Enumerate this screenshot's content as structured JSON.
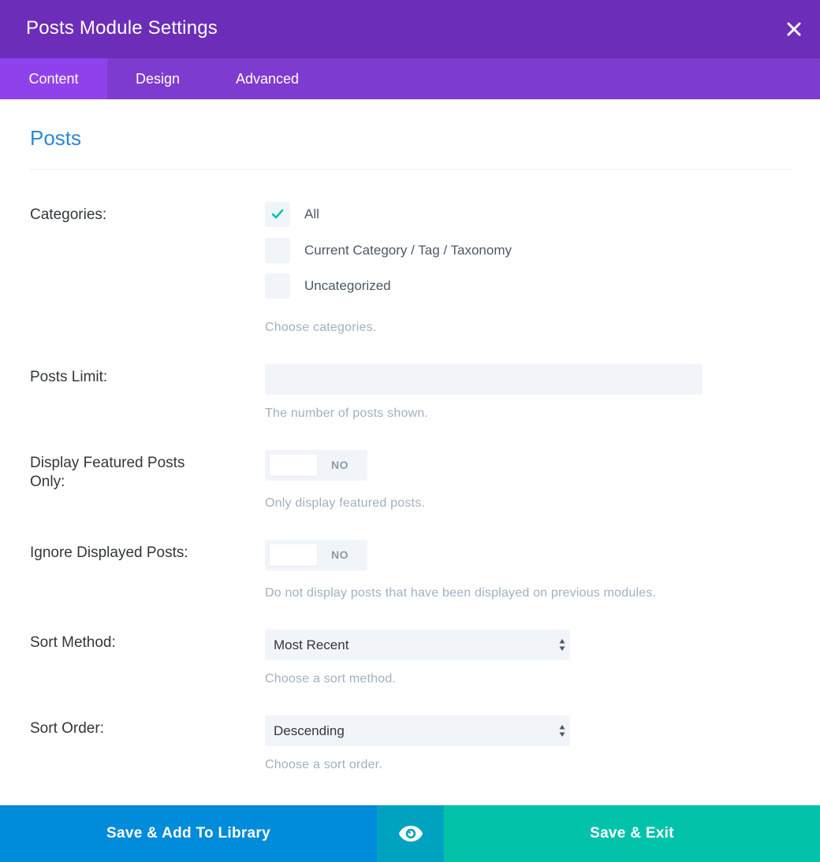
{
  "header": {
    "title": "Posts Module Settings",
    "close_icon": "close-icon"
  },
  "tabs": [
    {
      "label": "Content",
      "active": true
    },
    {
      "label": "Design",
      "active": false
    },
    {
      "label": "Advanced",
      "active": false
    }
  ],
  "section": {
    "title": "Posts"
  },
  "categories": {
    "label": "Categories:",
    "options": [
      {
        "label": "All",
        "checked": true
      },
      {
        "label": "Current Category / Tag / Taxonomy",
        "checked": false
      },
      {
        "label": "Uncategorized",
        "checked": false
      }
    ],
    "description": "Choose categories."
  },
  "posts_limit": {
    "label": "Posts Limit:",
    "value": "",
    "description": "The number of posts shown."
  },
  "featured_only": {
    "label": "Display Featured Posts Only:",
    "state": "NO",
    "description": "Only display featured posts."
  },
  "ignore_displayed": {
    "label": "Ignore Displayed Posts:",
    "state": "NO",
    "description": "Do not display posts that have been displayed on previous modules."
  },
  "sort_method": {
    "label": "Sort Method:",
    "value": "Most Recent",
    "description": "Choose a sort method."
  },
  "sort_order": {
    "label": "Sort Order:",
    "value": "Descending",
    "description": "Choose a sort order."
  },
  "footer": {
    "save_library_label": "Save & Add To Library",
    "preview_icon": "eye-icon",
    "save_exit_label": "Save & Exit"
  },
  "colors": {
    "header_bg": "#6c2eb9",
    "tabs_bg": "#7e3bd0",
    "active_tab": "#8f42ec",
    "accent_title": "#2b87da",
    "check": "#00c3aa",
    "save_library": "#008bdb",
    "preview": "#00a3bf",
    "save_exit": "#00c3aa"
  }
}
